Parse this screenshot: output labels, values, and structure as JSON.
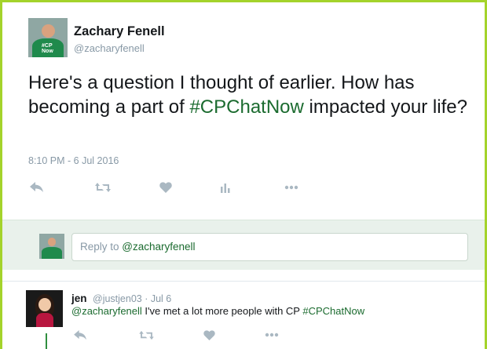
{
  "tweet": {
    "author_name": "Zachary Fenell",
    "author_handle": "@zacharyfenell",
    "text_before": "Here's a question I thought of earlier. How has becoming a part of ",
    "hashtag": "#CPChatNow",
    "text_after": " impacted your life?",
    "timestamp": "8:10 PM - 6 Jul 2016",
    "avatar_logo_line1": "#CP",
    "avatar_logo_line2": "Now",
    "actions": [
      "reply-icon",
      "retweet-icon",
      "like-icon",
      "analytics-icon",
      "more-icon"
    ]
  },
  "reply_box": {
    "prefix": "Reply to ",
    "mention": "@zacharyfenell"
  },
  "reply": {
    "author_name": "jen",
    "meta": "@justjen03 · Jul 6",
    "mention": "@zacharyfenell",
    "text": " I've met a lot more people with CP ",
    "hashtag": "#CPChatNow",
    "actions": [
      "reply-icon",
      "retweet-icon",
      "like-icon",
      "more-icon"
    ]
  },
  "colors": {
    "border": "#a4d32b",
    "hashtag": "#1b6b2f",
    "reply_bg": "#e9f1eb",
    "icon": "#aab8c2"
  }
}
